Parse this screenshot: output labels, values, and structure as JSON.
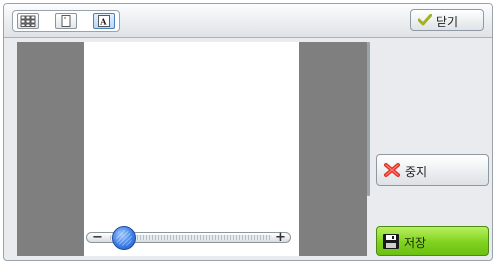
{
  "toolbar": {
    "view_buttons": [
      {
        "name": "thumbnail-grid-view-icon",
        "active": false
      },
      {
        "name": "single-page-view-icon",
        "active": false
      },
      {
        "name": "text-page-view-icon",
        "active": true
      }
    ],
    "close_label": "닫기"
  },
  "zoom": {
    "level": 0.12
  },
  "actions": {
    "stop_label": "중지",
    "save_label": "저장"
  },
  "colors": {
    "save_button": "#7fd21e",
    "stop_icon": "#e0302a",
    "active_view": "#b7d6f7"
  }
}
